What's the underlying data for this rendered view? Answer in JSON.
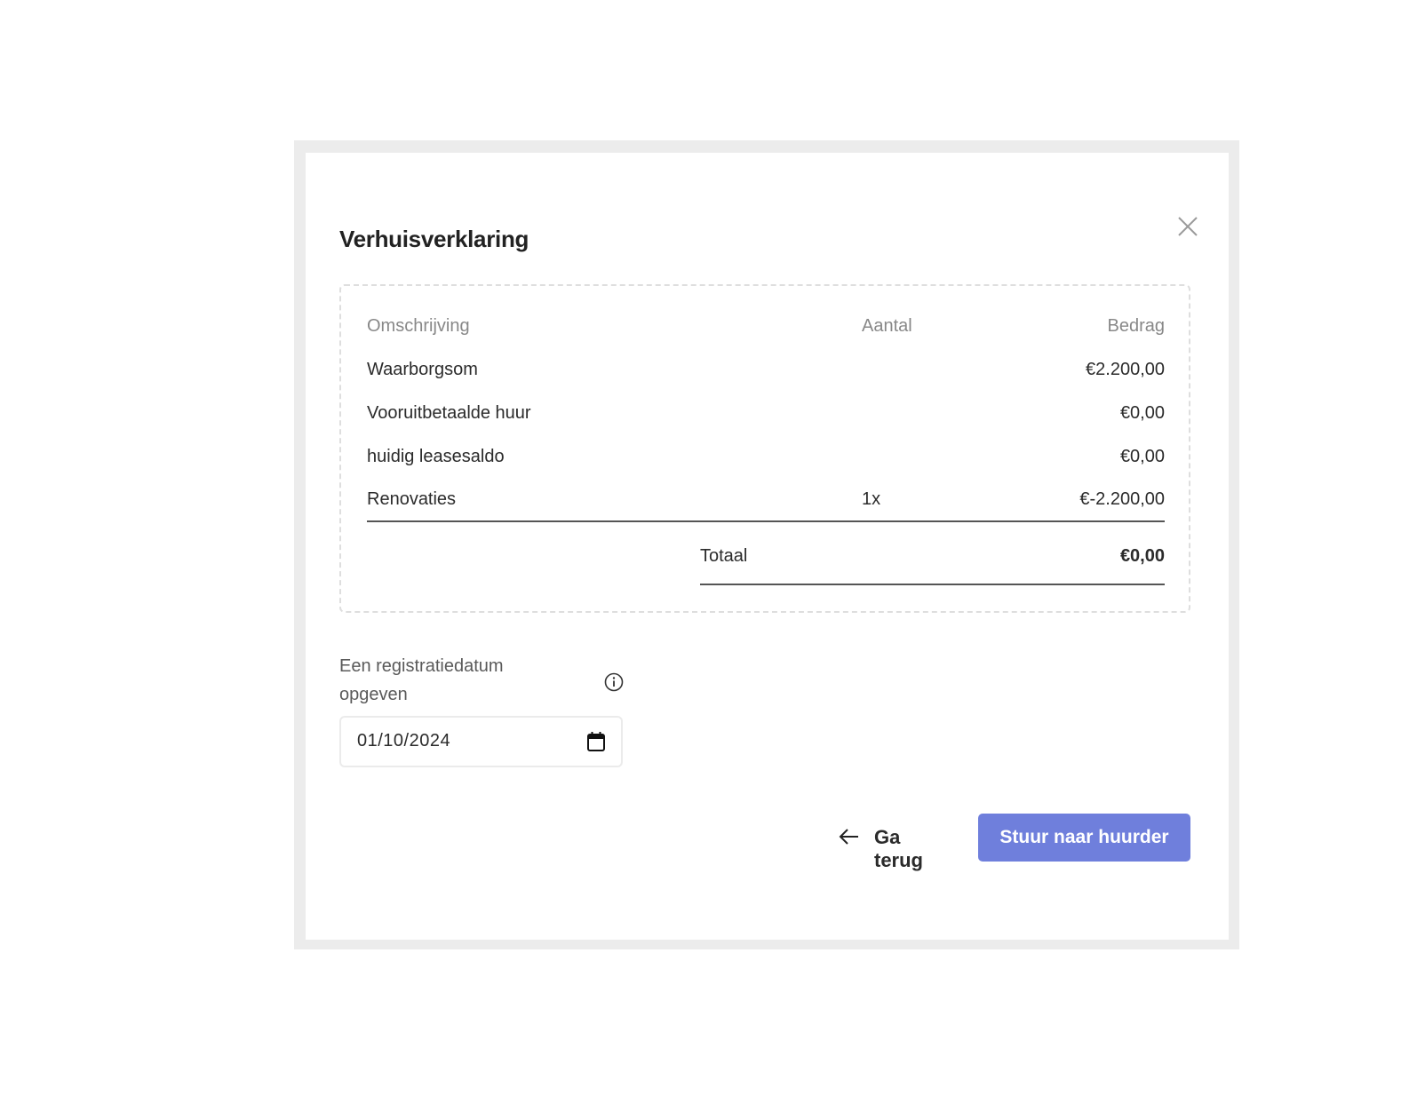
{
  "modal": {
    "title": "Verhuisverklaring",
    "close_icon": "close-icon"
  },
  "summary": {
    "headers": {
      "description": "Omschrijving",
      "quantity": "Aantal",
      "amount": "Bedrag"
    },
    "rows": [
      {
        "description": "Waarborgsom",
        "quantity": "",
        "amount": "€2.200,00"
      },
      {
        "description": "Vooruitbetaalde huur",
        "quantity": "",
        "amount": "€0,00"
      },
      {
        "description": "huidig leasesaldo",
        "quantity": "",
        "amount": "€0,00"
      },
      {
        "description": "Renovaties",
        "quantity": "1x",
        "amount": "€-2.200,00"
      }
    ],
    "total_label": "Totaal",
    "total_value": "€0,00"
  },
  "registration": {
    "label": "Een registratiedatum opgeven",
    "info_icon": "info-icon",
    "date_value": "01/10/2024",
    "calendar_icon": "calendar-icon"
  },
  "actions": {
    "back_label": "Ga terug",
    "back_icon": "arrow-left-icon",
    "send_label": "Stuur naar huurder",
    "send_color": "#6f7fdc"
  }
}
